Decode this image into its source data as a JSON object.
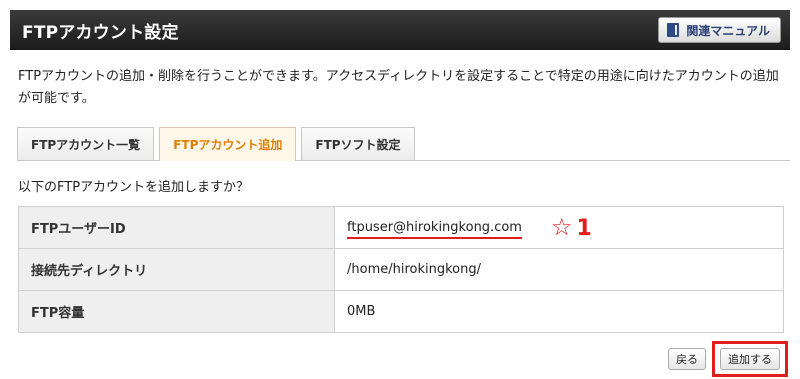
{
  "header": {
    "title": "FTPアカウント設定",
    "manual_button": "関連マニュアル"
  },
  "description": "FTPアカウントの追加・削除を行うことができます。アクセスディレクトリを設定することで特定の用途に向けたアカウントの追加が可能です。",
  "tabs": [
    {
      "label": "FTPアカウント一覧",
      "active": false
    },
    {
      "label": "FTPアカウント追加",
      "active": true
    },
    {
      "label": "FTPソフト設定",
      "active": false
    }
  ],
  "question": "以下のFTPアカウントを追加しますか？",
  "rows": [
    {
      "label": "FTPユーザーID",
      "value": "ftpuser@hirokingkong.com"
    },
    {
      "label": "接続先ディレクトリ",
      "value": "/home/hirokingkong/"
    },
    {
      "label": "FTP容量",
      "value": "0MB"
    }
  ],
  "annotation": {
    "star": "☆",
    "number": "1"
  },
  "buttons": {
    "back": "戻る",
    "submit": "追加する"
  },
  "colors": {
    "active_tab": "#e07f00",
    "highlight": "#e31c1c",
    "header_bg": "#1c1c1c"
  }
}
